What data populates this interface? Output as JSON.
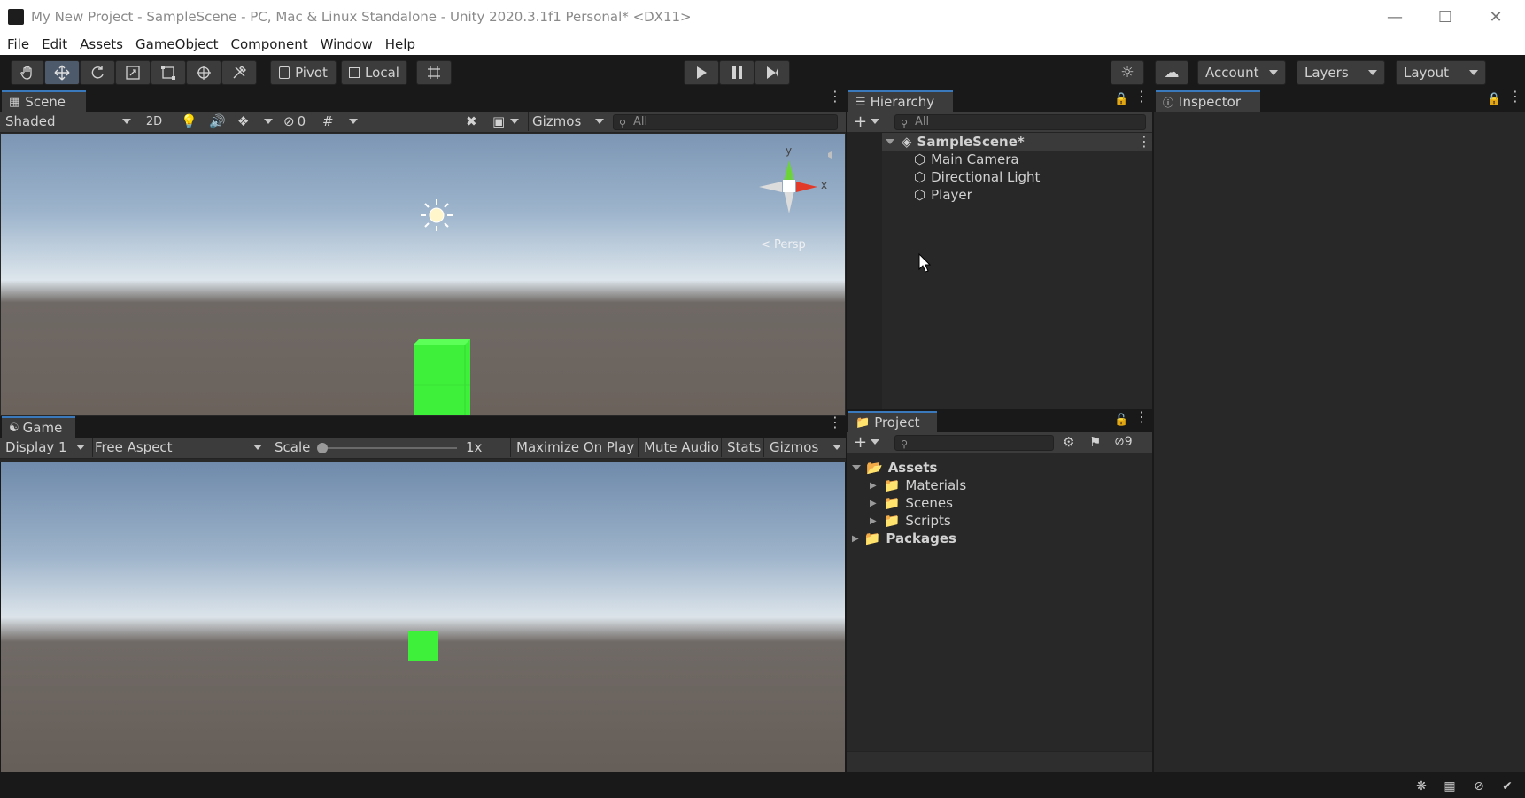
{
  "window": {
    "title": "My New Project - SampleScene - PC, Mac & Linux Standalone - Unity 2020.3.1f1 Personal* <DX11>"
  },
  "menu": [
    "File",
    "Edit",
    "Assets",
    "GameObject",
    "Component",
    "Window",
    "Help"
  ],
  "toolbar": {
    "pivot_label": "Pivot",
    "local_label": "Local",
    "account_label": "Account",
    "layers_label": "Layers",
    "layout_label": "Layout"
  },
  "scene": {
    "tab_label": "Scene",
    "shading_mode": "Shaded",
    "mode_2d": "2D",
    "hidden_count": "0",
    "gizmos_label": "Gizmos",
    "search_placeholder": "All",
    "gizmo_y": "y",
    "gizmo_x": "x",
    "persp_label": "< Persp"
  },
  "game": {
    "tab_label": "Game",
    "display": "Display 1",
    "aspect": "Free Aspect",
    "scale_label": "Scale",
    "scale_value": "1x",
    "maximize_label": "Maximize On Play",
    "mute_label": "Mute Audio",
    "stats_label": "Stats",
    "gizmos_label": "Gizmos"
  },
  "hierarchy": {
    "tab_label": "Hierarchy",
    "search_placeholder": "All",
    "scene_name": "SampleScene*",
    "items": [
      "Main Camera",
      "Directional Light",
      "Player"
    ]
  },
  "inspector": {
    "tab_label": "Inspector"
  },
  "project": {
    "tab_label": "Project",
    "hidden_count": "9",
    "assets_label": "Assets",
    "folders": [
      "Materials",
      "Scenes",
      "Scripts"
    ],
    "packages_label": "Packages"
  },
  "colors": {
    "accent": "#3a79bb",
    "cube_green": "#3ef03a",
    "panel_bg": "#282828",
    "toolbar_bg": "#3c3c3c"
  }
}
